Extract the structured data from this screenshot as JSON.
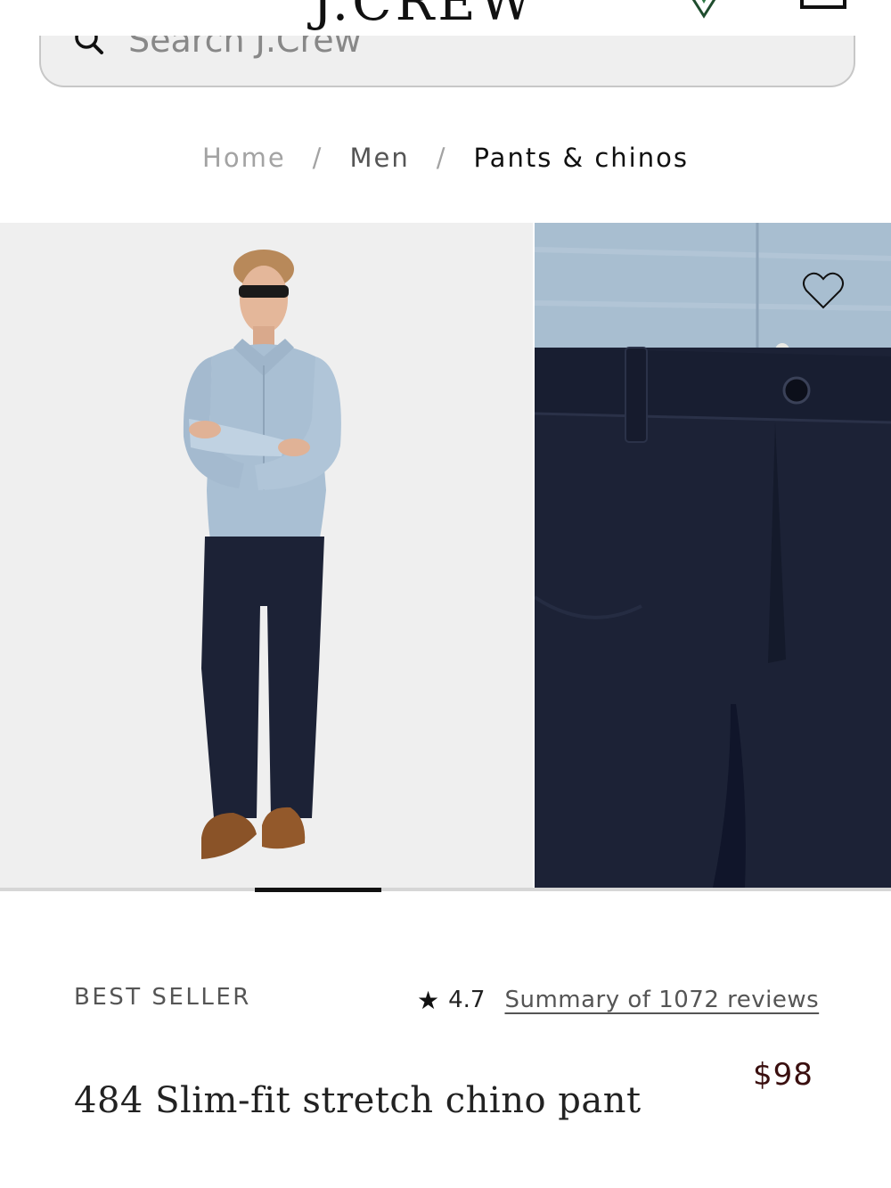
{
  "header": {
    "logo": "J.CREW",
    "store_icon": "location-pin-icon",
    "bag_icon": "shopping-bag-icon"
  },
  "search": {
    "placeholder": "Search J.Crew",
    "icon": "search-icon"
  },
  "breadcrumb": {
    "items": [
      "Home",
      "Men",
      "Pants & chinos"
    ],
    "separator": "/"
  },
  "gallery": {
    "images": [
      "model-full-body-photo",
      "pant-waistband-closeup-photo"
    ],
    "favorite_icon": "heart-outline-icon",
    "current_image": 2,
    "image_count": 7
  },
  "product": {
    "badge": "BEST SELLER",
    "rating": "4.7",
    "reviews_link": "Summary of 1072 reviews",
    "price": "$98",
    "title": "484 Slim-fit stretch chino pant"
  },
  "colors": {
    "price": "#3a0f0f",
    "pant_navy": "#1c2236",
    "shirt_chambray": "#a9bfd3"
  }
}
